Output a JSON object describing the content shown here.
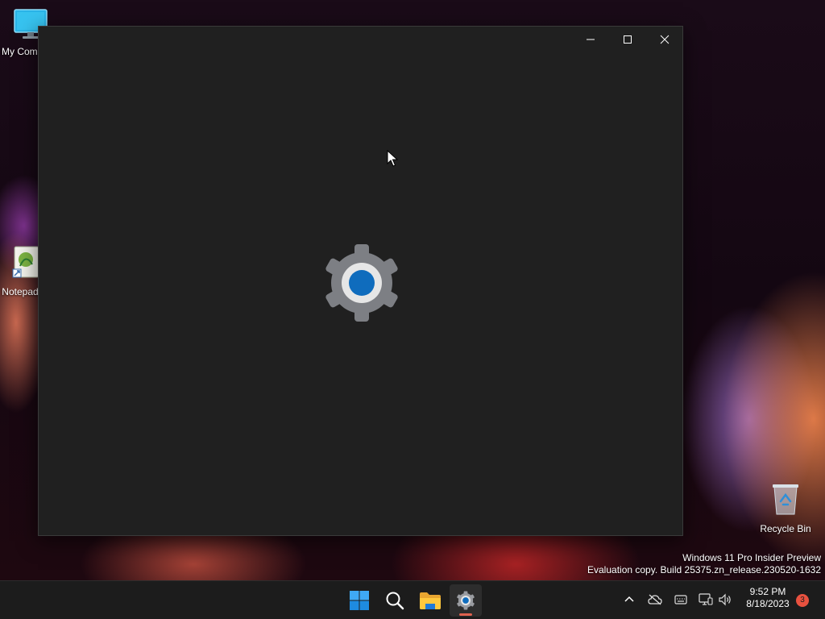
{
  "desktop": {
    "icons": [
      {
        "label": "My Computer",
        "icon": "monitor-icon"
      },
      {
        "label": "Notepad++",
        "icon": "notepad-icon"
      },
      {
        "label": "Recycle Bin",
        "icon": "recycle-bin-icon"
      }
    ],
    "watermark": {
      "line1": "Windows 11 Pro Insider Preview",
      "line2": "Evaluation copy. Build 25375.zn_release.230520-1632"
    }
  },
  "window": {
    "app": "Settings",
    "splash_icon": "gear-icon",
    "caption_buttons": [
      "minimize-icon",
      "maximize-icon",
      "close-icon"
    ]
  },
  "taskbar": {
    "apps": [
      {
        "name": "Start",
        "icon": "windows-logo-icon"
      },
      {
        "name": "Search",
        "icon": "search-icon"
      },
      {
        "name": "File Explorer",
        "icon": "folder-icon"
      },
      {
        "name": "Settings",
        "icon": "gear-icon",
        "active": true
      }
    ],
    "tray": [
      "chevron-up-icon",
      "onedrive-icon",
      "keyboard-icon",
      "network-icon",
      "volume-icon"
    ],
    "clock": {
      "time": "9:52 PM",
      "date": "8/18/2023"
    },
    "notification_count": "3"
  },
  "colors": {
    "window_bg": "#202020",
    "taskbar_bg": "#1c1c1c",
    "accent": "#0f6cbd",
    "badge": "#e8513f"
  }
}
